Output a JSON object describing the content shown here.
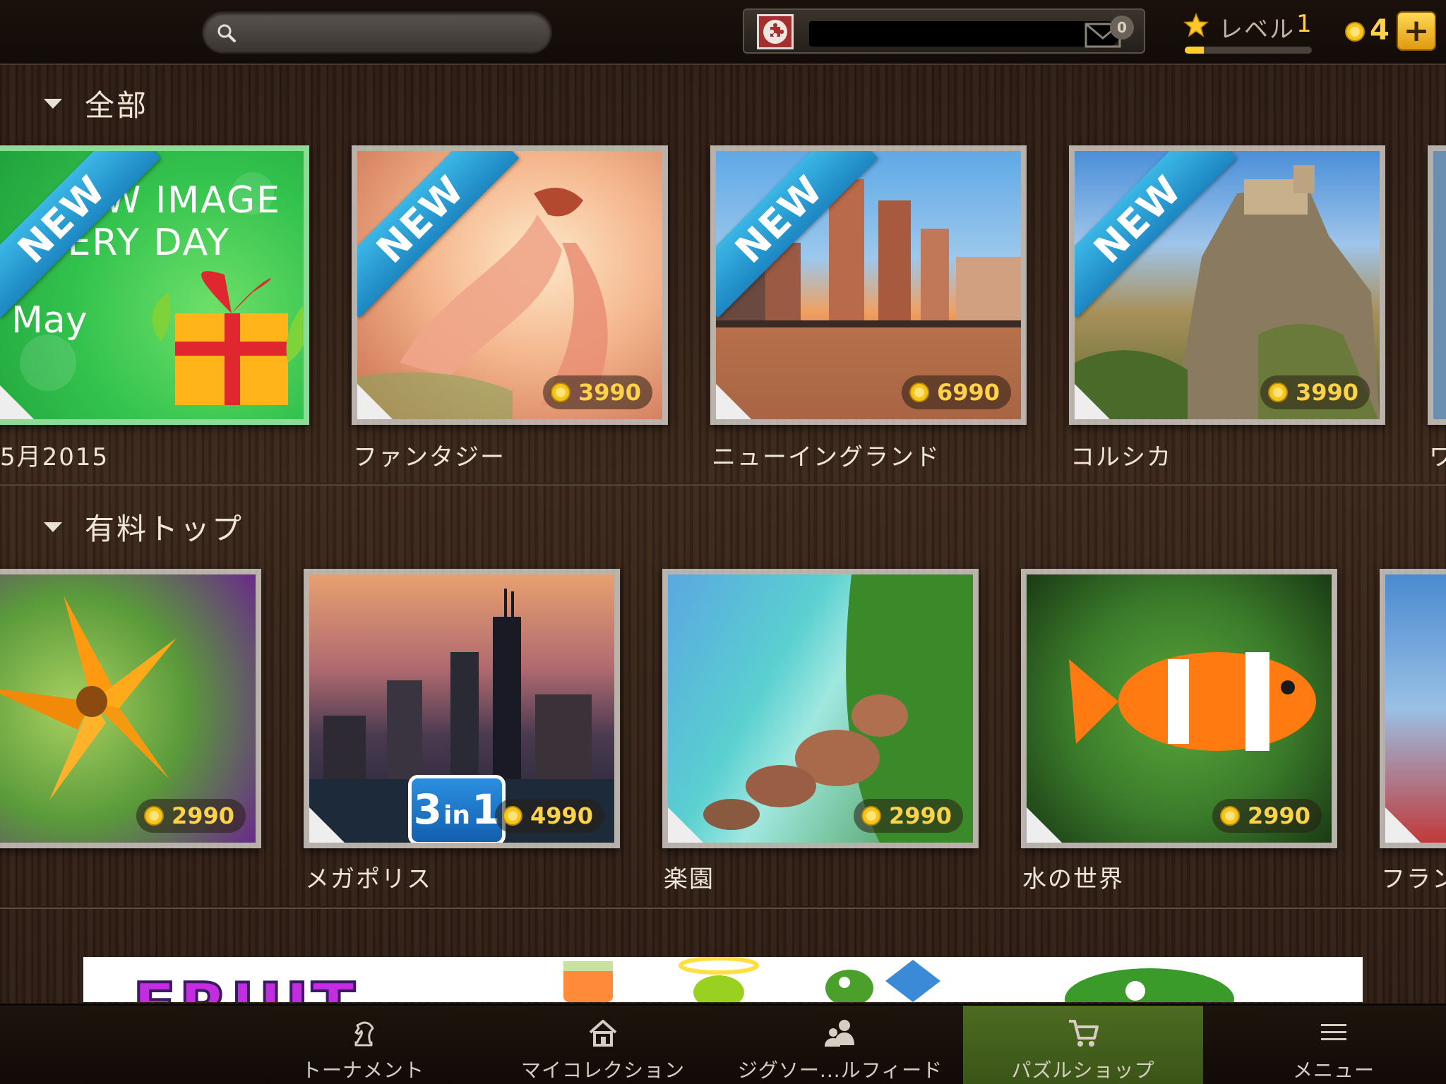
{
  "topbar": {
    "search_placeholder": "",
    "mail_count": "0",
    "level_label": "レベル",
    "level_value": "1",
    "xp_progress": 0.15,
    "coins": "4",
    "plus_label": "+"
  },
  "sections": [
    {
      "title": "全部",
      "tiles": [
        {
          "name": "5月2015",
          "label": "5月2015",
          "new": true,
          "price": "",
          "lines": [
            "W IMAGE",
            "VERY DAY",
            "May"
          ]
        },
        {
          "name": "ファンタジー",
          "label": "ファンタジー",
          "new": true,
          "price": "3990"
        },
        {
          "name": "ニューイングランド",
          "label": "ニューイングランド",
          "new": true,
          "price": "6990"
        },
        {
          "name": "コルシカ",
          "label": "コルシカ",
          "new": true,
          "price": "3990"
        },
        {
          "name": "partial",
          "label": "ワ"
        }
      ]
    },
    {
      "title": "有料トップ",
      "tiles": [
        {
          "name": "flowers",
          "label": "",
          "price": "2990"
        },
        {
          "name": "メガポリス",
          "label": "メガポリス",
          "price": "4990",
          "badge_big": "3",
          "badge_small": "in",
          "badge_big2": "1"
        },
        {
          "name": "楽園",
          "label": "楽園",
          "price": "2990"
        },
        {
          "name": "水の世界",
          "label": "水の世界",
          "price": "2990"
        },
        {
          "name": "partial2",
          "label": "フラン"
        }
      ]
    }
  ],
  "ribbon_text": "NEW",
  "ad": {
    "title": "FRUIT"
  },
  "nav": [
    {
      "label": "トーナメント",
      "icon": "chess-knight-icon"
    },
    {
      "label": "マイコレクション",
      "icon": "home-icon"
    },
    {
      "label": "ジグソー...ルフィード",
      "icon": "people-icon"
    },
    {
      "label": "パズルショップ",
      "icon": "cart-icon",
      "active": true
    },
    {
      "label": "メニュー",
      "icon": "menu-icon"
    }
  ],
  "colors": {
    "accent": "#ffd24a",
    "ribbon": "#2a9fd8",
    "active_nav": "#4d6b21"
  }
}
